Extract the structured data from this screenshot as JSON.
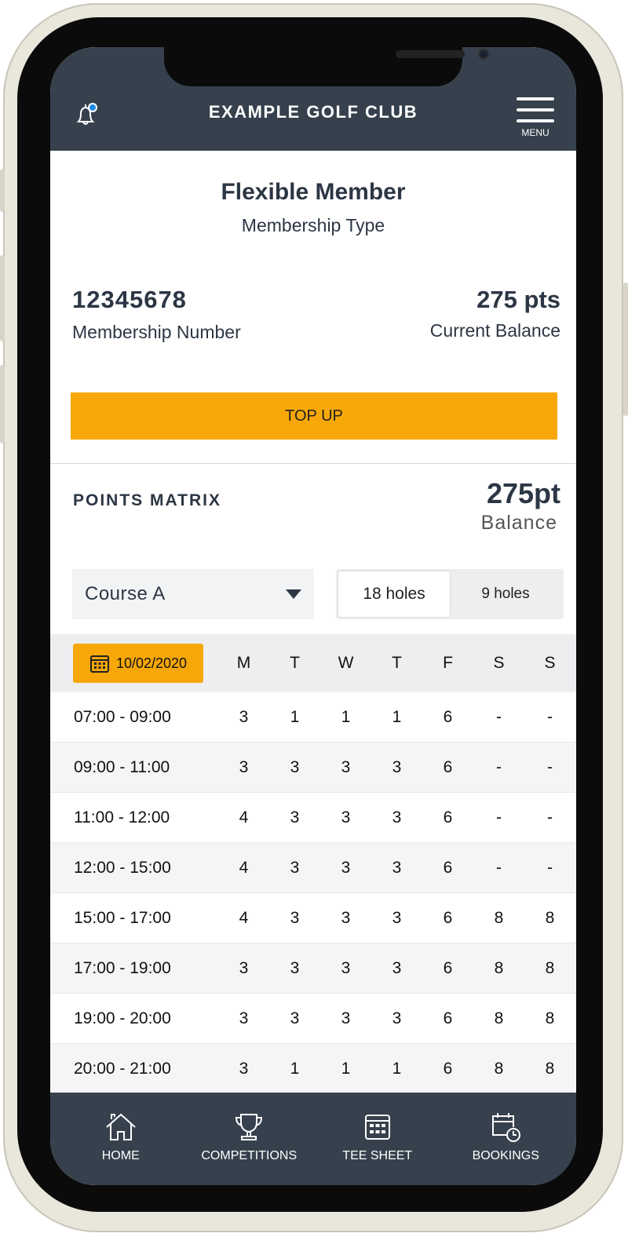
{
  "header": {
    "title": "EXAMPLE GOLF CLUB",
    "menu_label": "MENU",
    "bell_icon": "bell-with-notification-dot-icon",
    "notification_dot_color": "#1e88e5"
  },
  "membership": {
    "type": "Flexible Member",
    "type_label": "Membership Type",
    "number": "12345678",
    "number_label": "Membership Number",
    "balance": "275 pts",
    "balance_label": "Current Balance",
    "top_up_label": "TOP UP"
  },
  "points_matrix": {
    "title": "POINTS MATRIX",
    "balance": "275pt",
    "balance_label": "Balance",
    "course": "Course A",
    "holes_options": [
      "18 holes",
      "9 holes"
    ],
    "selected_holes": "18 holes",
    "date": "10/02/2020",
    "days": [
      "M",
      "T",
      "W",
      "T",
      "F",
      "S",
      "S"
    ],
    "rows": [
      {
        "time": "07:00 - 09:00",
        "values": [
          "3",
          "1",
          "1",
          "1",
          "6",
          "-",
          "-"
        ]
      },
      {
        "time": "09:00 - 11:00",
        "values": [
          "3",
          "3",
          "3",
          "3",
          "6",
          "-",
          "-"
        ]
      },
      {
        "time": "11:00 - 12:00",
        "values": [
          "4",
          "3",
          "3",
          "3",
          "6",
          "-",
          "-"
        ]
      },
      {
        "time": "12:00 - 15:00",
        "values": [
          "4",
          "3",
          "3",
          "3",
          "6",
          "-",
          "-"
        ]
      },
      {
        "time": "15:00 - 17:00",
        "values": [
          "4",
          "3",
          "3",
          "3",
          "6",
          "8",
          "8"
        ]
      },
      {
        "time": "17:00 - 19:00",
        "values": [
          "3",
          "3",
          "3",
          "3",
          "6",
          "8",
          "8"
        ]
      },
      {
        "time": "19:00 - 20:00",
        "values": [
          "3",
          "3",
          "3",
          "3",
          "6",
          "8",
          "8"
        ]
      },
      {
        "time": "20:00 - 21:00",
        "values": [
          "3",
          "1",
          "1",
          "1",
          "6",
          "8",
          "8"
        ]
      }
    ]
  },
  "footer": {
    "items": [
      {
        "label": "HOME",
        "icon": "home-icon"
      },
      {
        "label": "COMPETITIONS",
        "icon": "trophy-icon"
      },
      {
        "label": "TEE SHEET",
        "icon": "calendar-grid-icon"
      },
      {
        "label": "BOOKINGS",
        "icon": "calendar-clock-icon"
      }
    ]
  },
  "colors": {
    "header": "#36414d",
    "accent": "#f7a707",
    "text": "#2c3644"
  }
}
